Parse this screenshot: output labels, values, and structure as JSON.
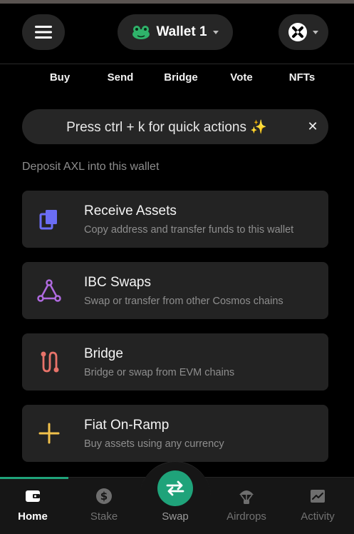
{
  "header": {
    "wallet_name": "Wallet 1"
  },
  "quick_nav": [
    "Buy",
    "Send",
    "Bridge",
    "Vote",
    "NFTs"
  ],
  "banner": {
    "text": "Press ctrl + k for quick actions ✨",
    "close_glyph": "✕"
  },
  "section_label": "Deposit AXL into this wallet",
  "cards": [
    {
      "title": "Receive Assets",
      "desc": "Copy address and transfer funds to this wallet",
      "icon": "copy-icon",
      "color": "#6b6df5"
    },
    {
      "title": "IBC Swaps",
      "desc": "Swap or transfer from other Cosmos chains",
      "icon": "triangle-network-icon",
      "color": "#b06ae0"
    },
    {
      "title": "Bridge",
      "desc": "Bridge or swap from EVM chains",
      "icon": "bridge-route-icon",
      "color": "#e8736a"
    },
    {
      "title": "Fiat On-Ramp",
      "desc": "Buy assets using any currency",
      "icon": "plus-icon",
      "color": "#f2c14b"
    }
  ],
  "bottom_nav": {
    "home": "Home",
    "stake": "Stake",
    "swap": "Swap",
    "airdrops": "Airdrops",
    "activity": "Activity"
  },
  "colors": {
    "accent": "#1fa37a",
    "background": "#000000",
    "card": "#232323"
  }
}
